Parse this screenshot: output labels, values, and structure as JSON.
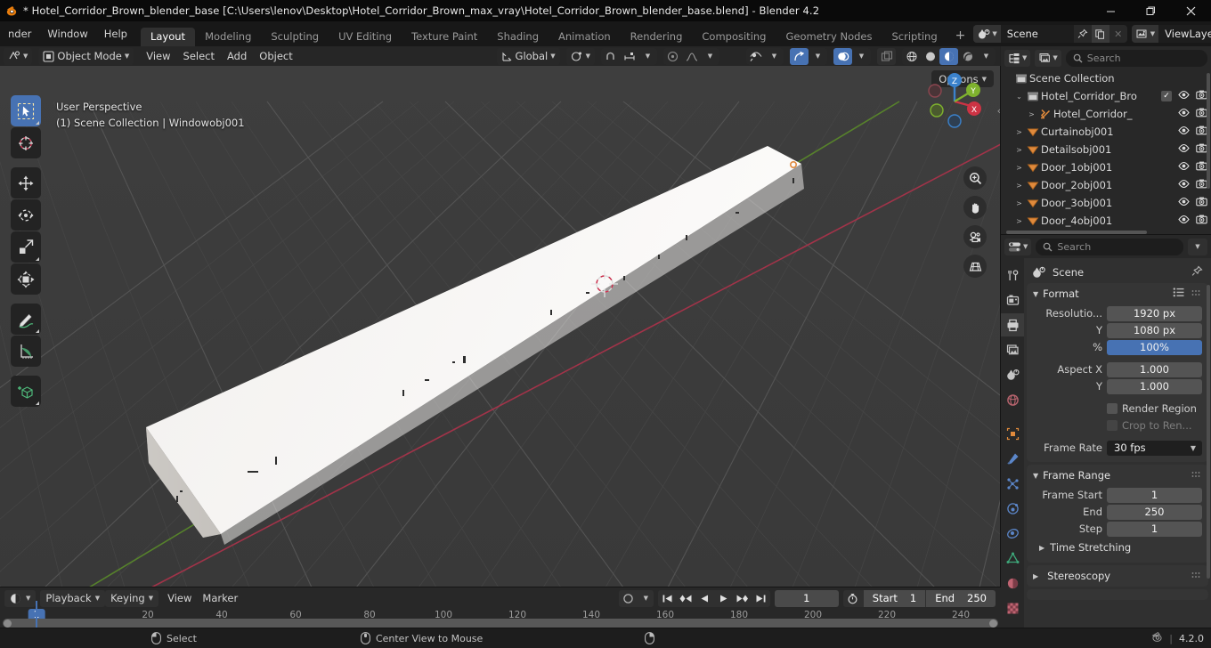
{
  "window": {
    "title": "* Hotel_Corridor_Brown_blender_base [C:\\Users\\lenov\\Desktop\\Hotel_Corridor_Brown_max_vray\\Hotel_Corridor_Brown_blender_base.blend] - Blender 4.2",
    "minimize": "—",
    "maximize": "❐",
    "close": "✕"
  },
  "menubar": {
    "items": [
      "nder",
      "Window",
      "Help"
    ]
  },
  "workspace_tabs": [
    {
      "label": "Layout",
      "active": true
    },
    {
      "label": "Modeling",
      "active": false
    },
    {
      "label": "Sculpting",
      "active": false
    },
    {
      "label": "UV Editing",
      "active": false
    },
    {
      "label": "Texture Paint",
      "active": false
    },
    {
      "label": "Shading",
      "active": false
    },
    {
      "label": "Animation",
      "active": false
    },
    {
      "label": "Rendering",
      "active": false
    },
    {
      "label": "Compositing",
      "active": false
    },
    {
      "label": "Geometry Nodes",
      "active": false
    },
    {
      "label": "Scripting",
      "active": false
    }
  ],
  "workspace_add": "+",
  "scene_selector": {
    "name": "Scene",
    "new_label": "",
    "unlink_label": "✕"
  },
  "viewlayer_selector": {
    "name": "ViewLayer",
    "new_label": "",
    "unlink_label": "✕"
  },
  "viewport_header": {
    "editor_type": "editor-type-3dview",
    "mode": "Object Mode",
    "menus": [
      "View",
      "Select",
      "Add",
      "Object"
    ],
    "transform_orientation": "Global",
    "snap_label": "",
    "proportional_label": "",
    "options_label": "Options"
  },
  "viewport_overlay": {
    "perspective": "User Perspective",
    "scene_info": "(1) Scene Collection | Windowobj001"
  },
  "viewport_toolbar": [
    {
      "name": "tweak-select-tool",
      "active": true
    },
    {
      "name": "cursor-tool",
      "active": false
    },
    {
      "name": "move-tool",
      "active": false
    },
    {
      "name": "rotate-tool",
      "active": false
    },
    {
      "name": "scale-tool",
      "active": false
    },
    {
      "name": "transform-tool",
      "active": false
    },
    {
      "name": "annotate-tool",
      "active": false
    },
    {
      "name": "measure-tool",
      "active": false
    },
    {
      "name": "add-cube-tool",
      "active": false
    }
  ],
  "gizmo_axes": {
    "x": "X",
    "y": "Y",
    "z": "Z"
  },
  "nav_buttons": [
    "zoom-icon",
    "hand-icon",
    "camera-icon",
    "grid-icon"
  ],
  "timeline": {
    "editor_type": "editor-type-timeline",
    "menus": [
      "Playback",
      "Keying",
      "View",
      "Marker"
    ],
    "current_frame": "1",
    "start_label": "Start",
    "start_value": "1",
    "end_label": "End",
    "end_value": "250",
    "ruler_ticks": [
      "20",
      "40",
      "60",
      "80",
      "100",
      "120",
      "140",
      "160",
      "180",
      "200",
      "220",
      "240"
    ],
    "playhead_label": "1"
  },
  "outliner": {
    "search_placeholder": "Search",
    "rows": [
      {
        "indent": 0,
        "expander": "",
        "icon": "collection-icon",
        "label": "Scene Collection",
        "checkbox": false,
        "eye": false,
        "camera": false
      },
      {
        "indent": 1,
        "expander": "⌄",
        "icon": "collection-icon",
        "label": "Hotel_Corridor_Bro",
        "checkbox": true,
        "eye": true,
        "camera": true
      },
      {
        "indent": 2,
        "expander": ">",
        "icon": "armature-icon",
        "label": "Hotel_Corridor_",
        "checkbox": false,
        "eye": true,
        "camera": true
      },
      {
        "indent": 1,
        "expander": ">",
        "icon": "mesh-icon",
        "label": "Curtainobj001",
        "checkbox": false,
        "eye": true,
        "camera": true
      },
      {
        "indent": 1,
        "expander": ">",
        "icon": "mesh-icon",
        "label": "Detailsobj001",
        "checkbox": false,
        "eye": true,
        "camera": true
      },
      {
        "indent": 1,
        "expander": ">",
        "icon": "mesh-icon",
        "label": "Door_1obj001",
        "checkbox": false,
        "eye": true,
        "camera": true
      },
      {
        "indent": 1,
        "expander": ">",
        "icon": "mesh-icon",
        "label": "Door_2obj001",
        "checkbox": false,
        "eye": true,
        "camera": true
      },
      {
        "indent": 1,
        "expander": ">",
        "icon": "mesh-icon",
        "label": "Door_3obj001",
        "checkbox": false,
        "eye": true,
        "camera": true
      },
      {
        "indent": 1,
        "expander": ">",
        "icon": "mesh-icon",
        "label": "Door_4obj001",
        "checkbox": false,
        "eye": true,
        "camera": true
      }
    ]
  },
  "properties": {
    "search_placeholder": "Search",
    "breadcrumb": "Scene",
    "tabs": [
      {
        "name": "tool-tab",
        "active": false
      },
      {
        "name": "render-tab",
        "active": false
      },
      {
        "name": "output-tab",
        "active": true
      },
      {
        "name": "view-layer-tab",
        "active": false
      },
      {
        "name": "scene-tab",
        "active": false
      },
      {
        "name": "world-tab",
        "active": false
      },
      {
        "name": "object-tab",
        "active": false
      },
      {
        "name": "modifier-tab",
        "active": false
      },
      {
        "name": "particles-tab",
        "active": false
      },
      {
        "name": "physics-tab",
        "active": false
      },
      {
        "name": "constraints-tab",
        "active": false
      },
      {
        "name": "data-tab",
        "active": false
      },
      {
        "name": "material-tab",
        "active": false
      },
      {
        "name": "texture-tab",
        "active": false
      }
    ],
    "format_panel": {
      "title": "Format",
      "rows": [
        {
          "label": "Resolutio...",
          "value": "1920 px",
          "style": "normal"
        },
        {
          "label": "Y",
          "value": "1080 px",
          "style": "normal"
        },
        {
          "label": "%",
          "value": "100%",
          "style": "blue"
        },
        {
          "label": "Aspect X",
          "value": "1.000",
          "style": "normal"
        },
        {
          "label": "Y",
          "value": "1.000",
          "style": "normal"
        }
      ],
      "checkboxes": [
        {
          "label": "Render Region",
          "dim": false
        },
        {
          "label": "Crop to Ren...",
          "dim": true
        }
      ],
      "frame_rate_label": "Frame Rate",
      "frame_rate_value": "30 fps"
    },
    "frame_range_panel": {
      "title": "Frame Range",
      "rows": [
        {
          "label": "Frame Start",
          "value": "1"
        },
        {
          "label": "End",
          "value": "250"
        },
        {
          "label": "Step",
          "value": "1"
        }
      ],
      "sub_panel": "Time Stretching"
    },
    "stereoscopy_panel": {
      "title": "Stereoscopy"
    }
  },
  "statusbar": {
    "left_action": "Select",
    "mid_action": "Center View to Mouse",
    "version": "4.2.0",
    "separator": "|"
  },
  "colors": {
    "accent_blue": "#4772b3",
    "viewport_bg": "#3b3b3b",
    "panel_bg": "#303030",
    "header_bg": "#282828",
    "window_bg": "#1d1d1d",
    "axis_x_red": "#cc3355",
    "axis_y_green": "#77bb33",
    "mesh_orange": "#e08a3c"
  }
}
